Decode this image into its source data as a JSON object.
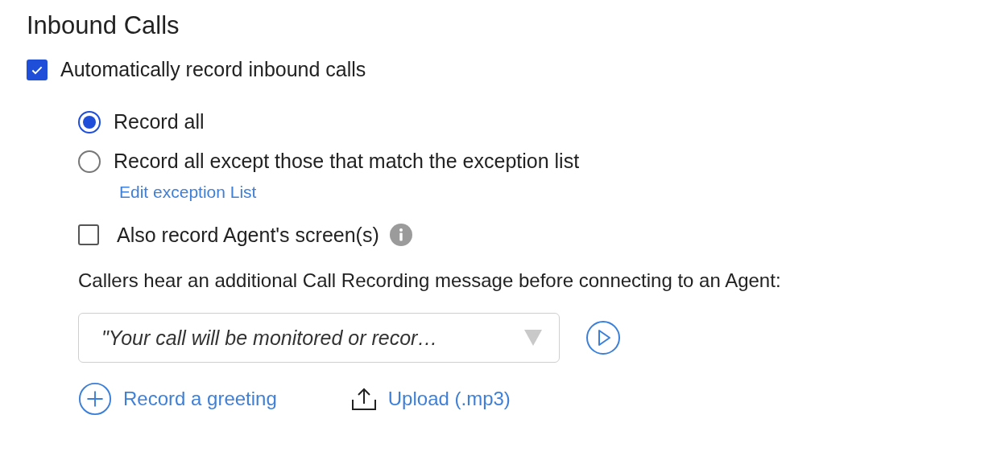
{
  "section_title": "Inbound Calls",
  "auto_record": {
    "label": "Automatically record inbound calls",
    "checked": true
  },
  "record_options": [
    {
      "label": "Record all",
      "selected": true
    },
    {
      "label": "Record all except those that match the exception list",
      "selected": false,
      "link": "Edit exception List"
    }
  ],
  "screen_record": {
    "label": "Also record Agent's screen(s)",
    "checked": false
  },
  "message_label": "Callers hear an additional Call Recording message before connecting to an Agent:",
  "message_select": {
    "value": "\"Your call will be monitored or recor…"
  },
  "actions": [
    {
      "kind": "record",
      "label": "Record a greeting"
    },
    {
      "kind": "upload",
      "label": "Upload (.mp3)"
    }
  ]
}
